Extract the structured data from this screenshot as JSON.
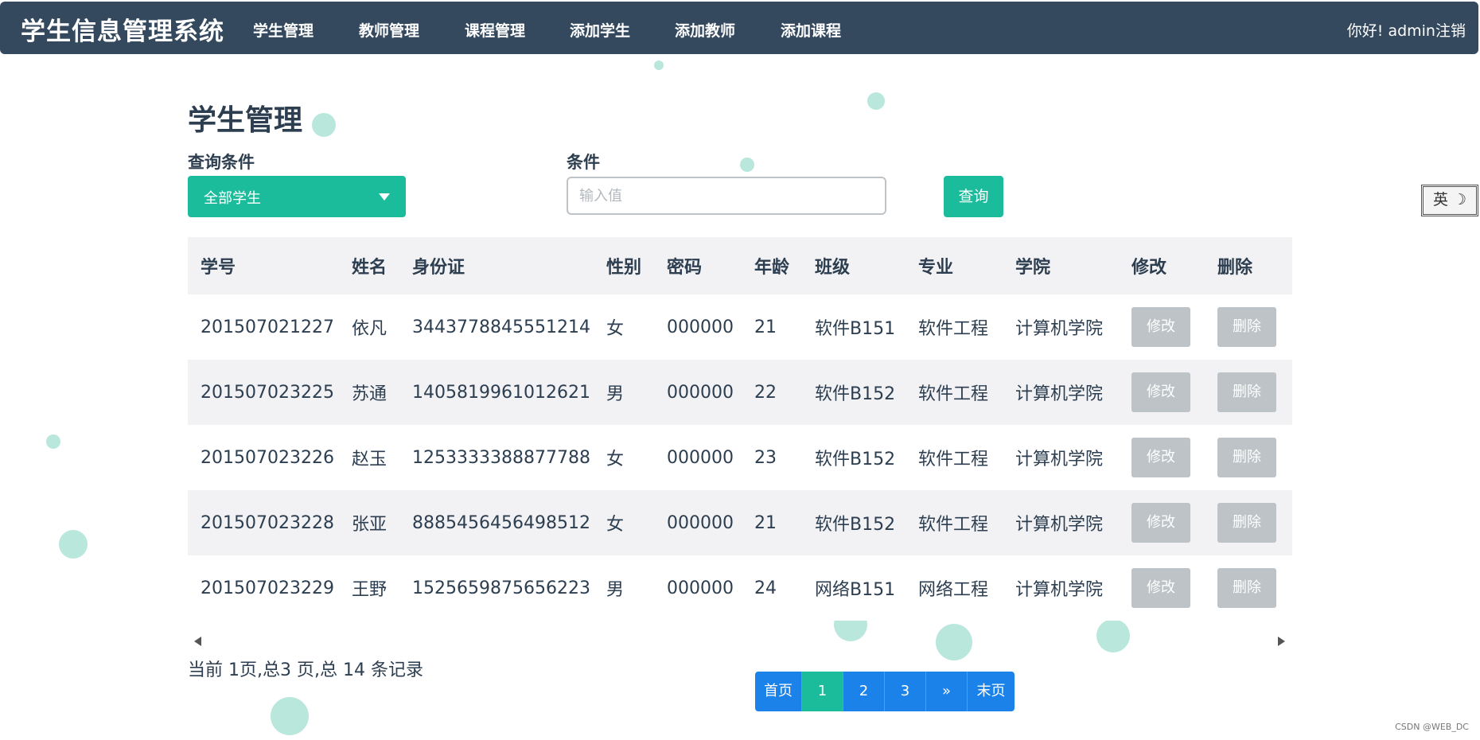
{
  "app": {
    "title": "学生信息管理系统"
  },
  "nav": {
    "items": [
      {
        "label": "学生管理"
      },
      {
        "label": "教师管理"
      },
      {
        "label": "课程管理"
      },
      {
        "label": "添加学生"
      },
      {
        "label": "添加教师"
      },
      {
        "label": "添加课程"
      }
    ],
    "user": {
      "greeting": "你好!",
      "name": "admin",
      "logout": "注销"
    }
  },
  "main": {
    "title": "学生管理",
    "filter": {
      "label": "查询条件",
      "selected": "全部学生",
      "value_label": "条件",
      "value_placeholder": "输入值",
      "query_button": "查询"
    }
  },
  "table": {
    "columns": [
      "学号",
      "姓名",
      "身份证",
      "性别",
      "密码",
      "年龄",
      "班级",
      "专业",
      "学院",
      "修改",
      "删除"
    ],
    "rows": [
      {
        "id": "201507021227",
        "name": "依凡",
        "idcard": "3443778845551214",
        "gender": "女",
        "password": "000000",
        "age": "21",
        "class": "软件B151",
        "major": "软件工程",
        "college": "计算机学院",
        "edit": "修改",
        "delete": "删除"
      },
      {
        "id": "201507023225",
        "name": "苏通",
        "idcard": "1405819961012621",
        "gender": "男",
        "password": "000000",
        "age": "22",
        "class": "软件B152",
        "major": "软件工程",
        "college": "计算机学院",
        "edit": "修改",
        "delete": "删除"
      },
      {
        "id": "201507023226",
        "name": "赵玉",
        "idcard": "1253333388877788",
        "gender": "女",
        "password": "000000",
        "age": "23",
        "class": "软件B152",
        "major": "软件工程",
        "college": "计算机学院",
        "edit": "修改",
        "delete": "删除"
      },
      {
        "id": "201507023228",
        "name": "张亚",
        "idcard": "8885456456498512",
        "gender": "女",
        "password": "000000",
        "age": "21",
        "class": "软件B152",
        "major": "软件工程",
        "college": "计算机学院",
        "edit": "修改",
        "delete": "删除"
      },
      {
        "id": "201507023229",
        "name": "王野",
        "idcard": "1525659875656223",
        "gender": "男",
        "password": "000000",
        "age": "24",
        "class": "网络B151",
        "major": "网络工程",
        "college": "计算机学院",
        "edit": "修改",
        "delete": "删除"
      }
    ]
  },
  "footer": {
    "record_info": "当前 1页,总3 页,总 14 条记录",
    "pagination": {
      "first": "首页",
      "pages": [
        "1",
        "2",
        "3"
      ],
      "next": "»",
      "last": "末页",
      "current": "1"
    }
  },
  "ime": {
    "label": "英 ☽"
  },
  "watermark": "CSDN @WEB_DC",
  "colors": {
    "navbar": "#34495e",
    "accent": "#1abc9c",
    "page_button": "#1a82e8",
    "mini_button": "#bdc3c7"
  }
}
